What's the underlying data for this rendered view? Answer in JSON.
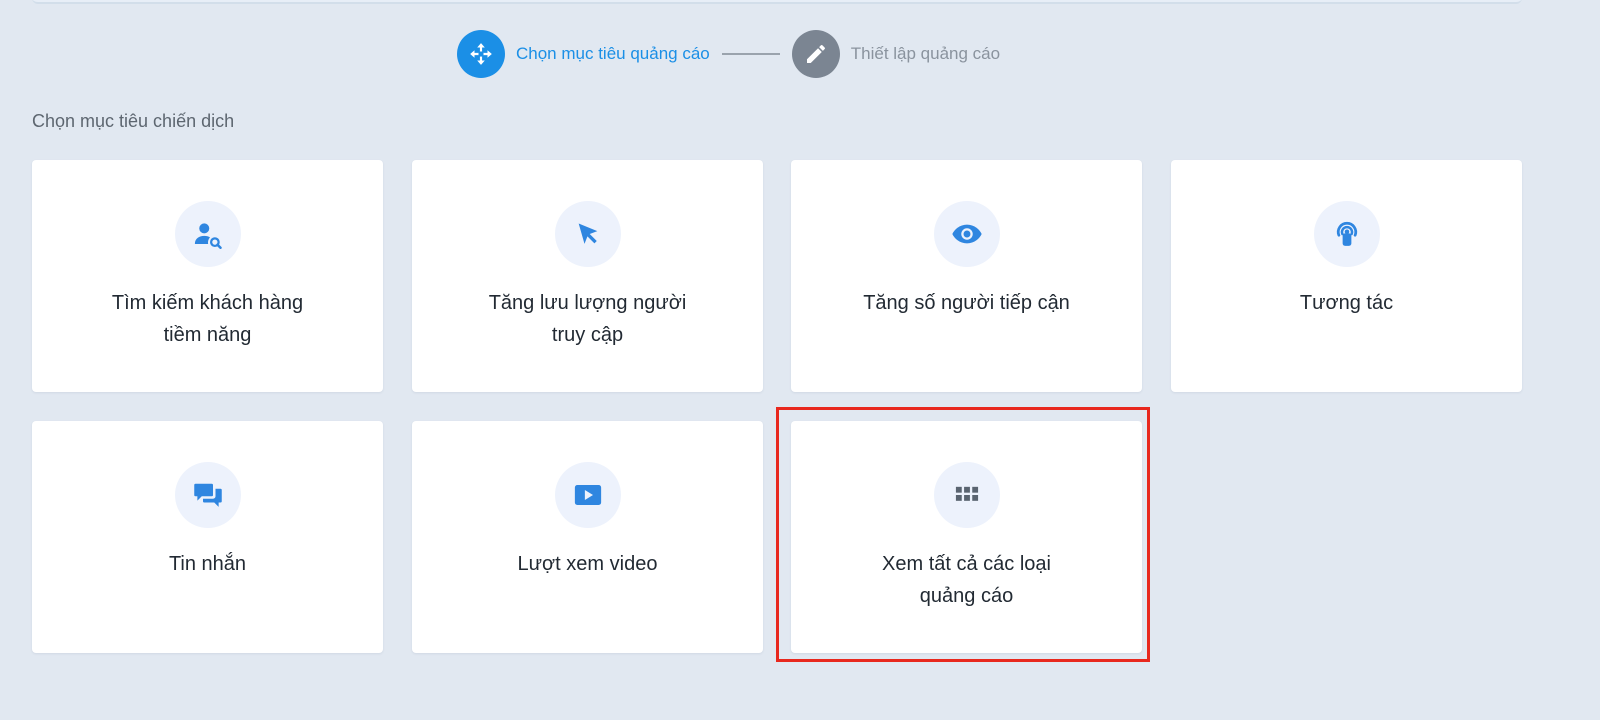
{
  "stepper": {
    "steps": [
      {
        "label": "Chọn mục tiêu quảng cáo",
        "state": "active",
        "icon": "move-arrows-icon"
      },
      {
        "label": "Thiết lập quảng cáo",
        "state": "inactive",
        "icon": "pencil-icon"
      }
    ]
  },
  "section": {
    "title": "Chọn mục tiêu chiến dịch"
  },
  "objectives": [
    {
      "line1": "Tìm kiếm khách hàng",
      "line2": "tiềm năng",
      "icon": "user-search-icon"
    },
    {
      "line1": "Tăng lưu lượng người",
      "line2": "truy cập",
      "icon": "cursor-arrow-icon"
    },
    {
      "line1": "Tăng số người tiếp cận",
      "line2": "",
      "icon": "eye-icon"
    },
    {
      "line1": "Tương tác",
      "line2": "",
      "icon": "tap-signal-icon"
    },
    {
      "line1": "Tin nhắn",
      "line2": "",
      "icon": "chat-bubbles-icon"
    },
    {
      "line1": "Lượt xem video",
      "line2": "",
      "icon": "video-play-icon"
    },
    {
      "line1": "Xem tất cả các loại",
      "line2": "quảng cáo",
      "icon": "grid-apps-icon"
    }
  ],
  "colors": {
    "background": "#e1e8f1",
    "accent": "#1b8fe6",
    "inactive": "#7b8592",
    "icon": "#2f86e0",
    "icon_bg": "#edf2fc",
    "highlight": "#e8281e"
  }
}
